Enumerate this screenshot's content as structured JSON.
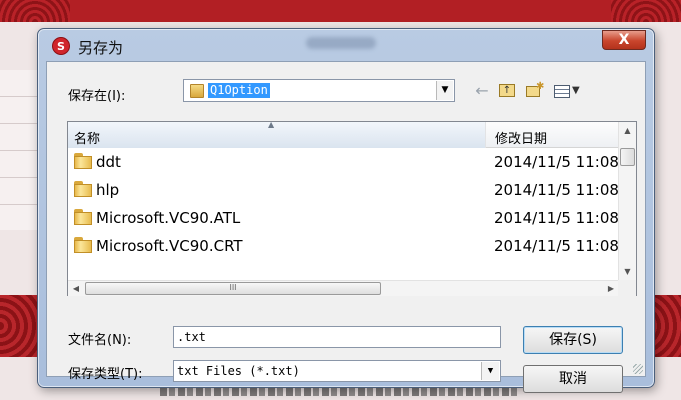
{
  "dialog": {
    "title": "另存为",
    "app_icon": "S",
    "close_label": "X",
    "save_in_label": "保存在(I):",
    "current_folder": "Q1Option",
    "columns": {
      "name": "名称",
      "date_modified": "修改日期"
    },
    "files": [
      {
        "name": "ddt",
        "date": "2014/11/5 11:08",
        "icon": "folder-icon"
      },
      {
        "name": "hlp",
        "date": "2014/11/5 11:08",
        "icon": "folder-icon"
      },
      {
        "name": "Microsoft.VC90.ATL",
        "date": "2014/11/5 11:08",
        "icon": "folder-icon"
      },
      {
        "name": "Microsoft.VC90.CRT",
        "date": "2014/11/5 11:08",
        "icon": "folder-icon"
      }
    ],
    "file_name_label": "文件名(N):",
    "file_name_value": ".txt",
    "file_type_label": "保存类型(T):",
    "file_type_value": "txt Files (*.txt)",
    "save_button": "保存(S)",
    "cancel_button": "取消",
    "hscroll_grip": "III"
  },
  "colors": {
    "background_red": "#b21f24",
    "dialog_frame": "#b9cbe3",
    "selection": "#3399ff",
    "close_button": "#c9452c"
  }
}
